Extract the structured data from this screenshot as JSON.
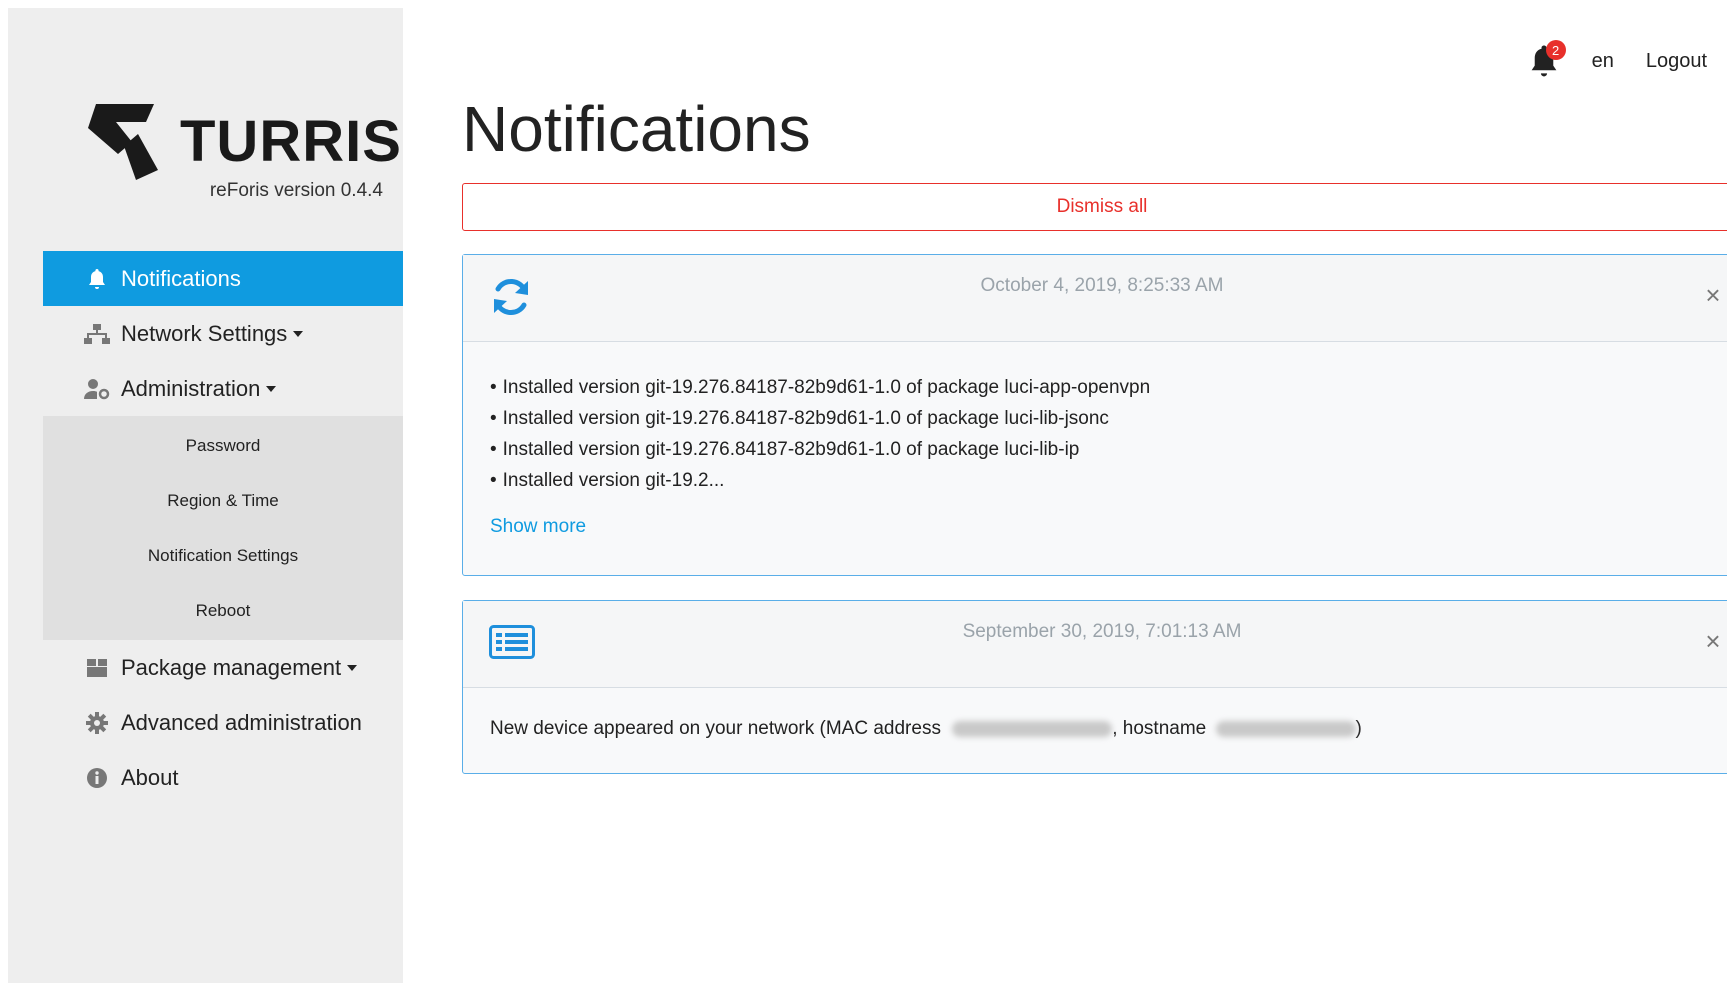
{
  "sidebar": {
    "logo_text": "TURRIS",
    "version": "reForis version 0.4.4",
    "items": [
      {
        "label": "Notifications",
        "icon": "bell-icon",
        "active": true
      },
      {
        "label": "Network Settings",
        "icon": "network-icon",
        "dropdown": true
      },
      {
        "label": "Administration",
        "icon": "user-gear-icon",
        "dropdown": true
      },
      {
        "label": "Package management",
        "icon": "package-icon",
        "dropdown": true
      },
      {
        "label": "Advanced administration",
        "icon": "gear-icon"
      },
      {
        "label": "About",
        "icon": "info-icon"
      }
    ],
    "administration_sub": [
      "Password",
      "Region & Time",
      "Notification Settings",
      "Reboot"
    ]
  },
  "header": {
    "notification_count": "2",
    "language": "en",
    "logout": "Logout"
  },
  "main": {
    "title": "Notifications",
    "dismiss_all": "Dismiss all",
    "notifications": [
      {
        "icon": "refresh-icon",
        "timestamp": "October 4, 2019, 8:25:33 AM",
        "lines": [
          "Installed version git-19.276.84187-82b9d61-1.0 of package luci-app-openvpn",
          "Installed version git-19.276.84187-82b9d61-1.0 of package luci-lib-jsonc",
          "Installed version git-19.276.84187-82b9d61-1.0 of package luci-lib-ip",
          "Installed version git-19.2..."
        ],
        "show_more": "Show more"
      },
      {
        "icon": "list-icon",
        "timestamp": "September 30, 2019, 7:01:13 AM",
        "text_before": "New device appeared on your  network (MAC address",
        "text_mid": ", hostname",
        "text_end": ")"
      }
    ]
  },
  "colors": {
    "accent": "#0f9be0",
    "danger": "#e8302b",
    "sidebar_bg": "#eeeeee"
  }
}
